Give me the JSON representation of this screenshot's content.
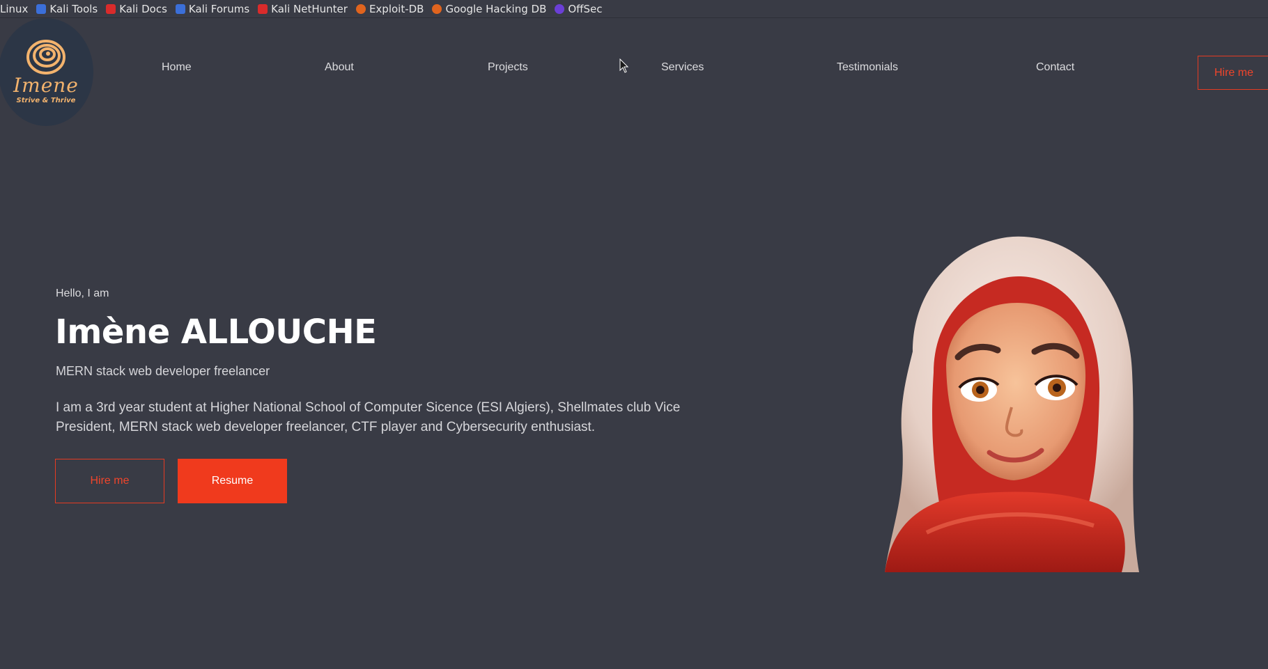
{
  "bookmarks": [
    {
      "label": "Linux",
      "icon": "none",
      "color": ""
    },
    {
      "label": "Kali Tools",
      "icon": "kali-tools-icon",
      "color": "#3b6fd9"
    },
    {
      "label": "Kali Docs",
      "icon": "kali-docs-icon",
      "color": "#d92b2b"
    },
    {
      "label": "Kali Forums",
      "icon": "kali-forums-icon",
      "color": "#3b6fd9"
    },
    {
      "label": "Kali NetHunter",
      "icon": "kali-nethunter-icon",
      "color": "#d92b2b"
    },
    {
      "label": "Exploit-DB",
      "icon": "exploit-db-icon",
      "color": "#e0641e"
    },
    {
      "label": "Google Hacking DB",
      "icon": "google-hacking-db-icon",
      "color": "#e0641e"
    },
    {
      "label": "OffSec",
      "icon": "offsec-icon",
      "color": "#6b3fd6"
    }
  ],
  "logo": {
    "name": "Imene",
    "tagline": "Strive & Thrive"
  },
  "nav": {
    "items": [
      "Home",
      "About",
      "Projects",
      "Services",
      "Testimonials",
      "Contact"
    ],
    "hire_label": "Hire me"
  },
  "hero": {
    "greeting": "Hello, I am",
    "name": "Imène ALLOUCHE",
    "role": "MERN stack web developer freelancer",
    "description": "I am a 3rd year student at Higher National School of Computer Sicence (ESI Algiers), Shellmates club Vice President, MERN stack web developer freelancer, CTF player and Cybersecurity enthusiast.",
    "hire_label": "Hire me",
    "resume_label": "Resume"
  },
  "colors": {
    "background": "#393b45",
    "accent": "#f03a1d",
    "logo": "#f3b36d"
  }
}
